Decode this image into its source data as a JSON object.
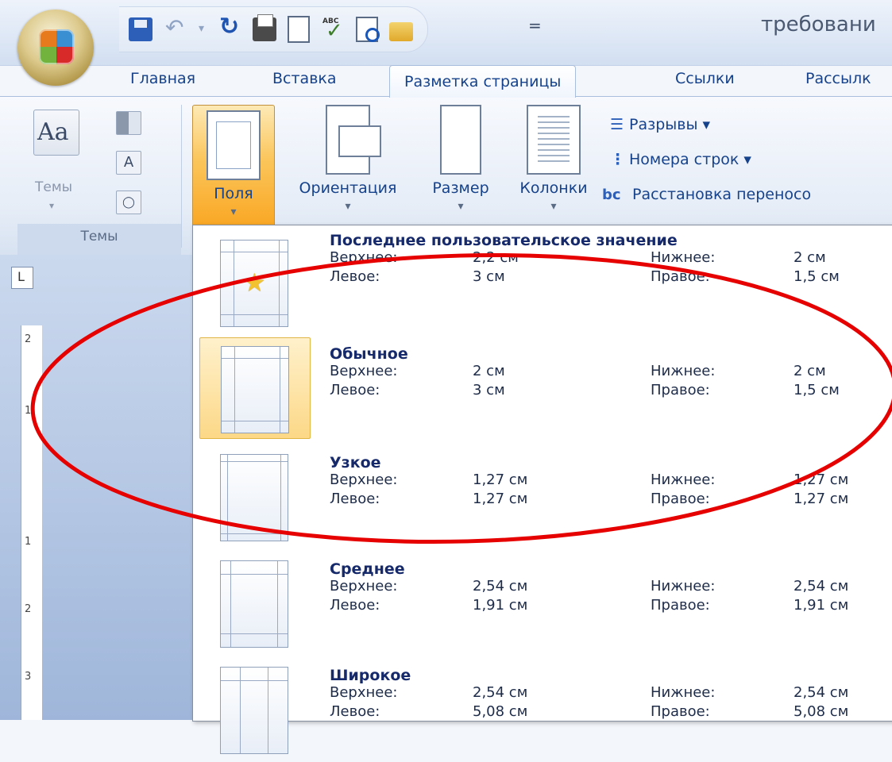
{
  "window": {
    "document_title": "требовани"
  },
  "quick_access": {
    "icons": [
      "save-icon",
      "undo-icon",
      "undo-dropdown-icon",
      "redo-icon",
      "print-icon",
      "new-document-icon",
      "spelling-icon",
      "print-preview-icon",
      "open-folder-icon"
    ],
    "more": "="
  },
  "tabs": [
    {
      "label": "Главная"
    },
    {
      "label": "Вставка"
    },
    {
      "label": "Разметка страницы",
      "active": true
    },
    {
      "label": "Ссылки"
    },
    {
      "label": "Рассылк"
    }
  ],
  "ribbon": {
    "themes": {
      "button_label": "Темы",
      "group_caption": "Темы",
      "big_glyph": "Aa",
      "font_glyph": "A"
    },
    "page_setup": {
      "fields_label": "Поля",
      "orientation_label": "Ориентация",
      "size_label": "Размер",
      "columns_label": "Колонки",
      "breaks_label": "Разрывы ▾",
      "line_numbers_label": "Номера строк ▾",
      "hyphenation_label": "Расстановка переносо",
      "hyphenation_glyph": "bc"
    }
  },
  "ruler": {
    "corner": "L",
    "ticks": [
      "2",
      "1",
      "1",
      "2",
      "3"
    ]
  },
  "margins_gallery": {
    "items": [
      {
        "name": "Последнее пользовательское значение",
        "top_label": "Верхнее:",
        "top": "2,2 см",
        "bottom_label": "Нижнее:",
        "bottom": "2 см",
        "left_label": "Левое:",
        "left": "3 см",
        "right_label": "Правое:",
        "right": "1,5 см",
        "highlighted": false
      },
      {
        "name": "Обычное",
        "top_label": "Верхнее:",
        "top": "2 см",
        "bottom_label": "Нижнее:",
        "bottom": "2 см",
        "left_label": "Левое:",
        "left": "3 см",
        "right_label": "Правое:",
        "right": "1,5 см",
        "highlighted": true
      },
      {
        "name": "Узкое",
        "top_label": "Верхнее:",
        "top": "1,27 см",
        "bottom_label": "Нижнее:",
        "bottom": "1,27 см",
        "left_label": "Левое:",
        "left": "1,27 см",
        "right_label": "Правое:",
        "right": "1,27 см",
        "highlighted": false
      },
      {
        "name": "Среднее",
        "top_label": "Верхнее:",
        "top": "2,54 см",
        "bottom_label": "Нижнее:",
        "bottom": "2,54 см",
        "left_label": "Левое:",
        "left": "1,91 см",
        "right_label": "Правое:",
        "right": "1,91 см",
        "highlighted": false
      },
      {
        "name": "Широкое",
        "top_label": "Верхнее:",
        "top": "2,54 см",
        "bottom_label": "Нижнее:",
        "bottom": "2,54 см",
        "left_label": "Левое:",
        "left": "5,08 см",
        "right_label": "Правое:",
        "right": "5,08 см",
        "highlighted": false
      }
    ]
  },
  "colors": {
    "accent": "#15428b",
    "annotation": "#e60000",
    "selected": "#fbc55a"
  }
}
